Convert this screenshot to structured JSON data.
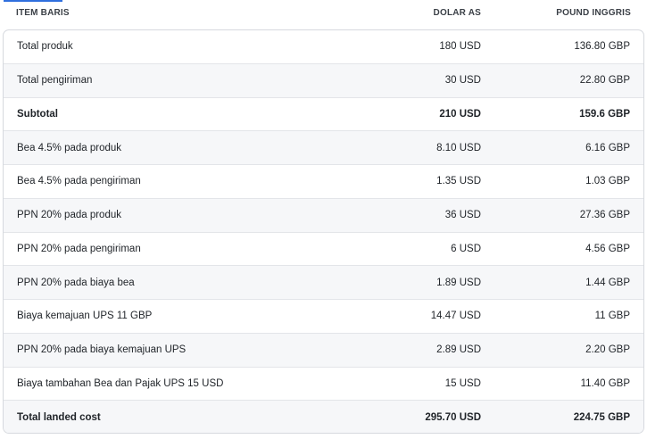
{
  "table": {
    "headers": {
      "item": "ITEM BARIS",
      "usd": "DOLAR AS",
      "gbp": "POUND INGGRIS"
    },
    "rows": [
      {
        "item": "Total produk",
        "usd": "180 USD",
        "gbp": "136.80 GBP"
      },
      {
        "item": "Total pengiriman",
        "usd": "30 USD",
        "gbp": "22.80 GBP"
      },
      {
        "item": "Subtotal",
        "usd": "210 USD",
        "gbp": "159.6 GBP"
      },
      {
        "item": "Bea 4.5% pada produk",
        "usd": "8.10 USD",
        "gbp": "6.16 GBP"
      },
      {
        "item": "Bea 4.5% pada pengiriman",
        "usd": "1.35 USD",
        "gbp": "1.03 GBP"
      },
      {
        "item": "PPN 20% pada produk",
        "usd": "36 USD",
        "gbp": "27.36 GBP"
      },
      {
        "item": "PPN 20% pada pengiriman",
        "usd": "6 USD",
        "gbp": "4.56 GBP"
      },
      {
        "item": "PPN 20% pada biaya bea",
        "usd": "1.89 USD",
        "gbp": "1.44 GBP"
      },
      {
        "item": "Biaya kemajuan UPS 11 GBP",
        "usd": "14.47 USD",
        "gbp": "11 GBP"
      },
      {
        "item": "PPN 20% pada biaya kemajuan UPS",
        "usd": "2.89 USD",
        "gbp": "2.20 GBP"
      },
      {
        "item": "Biaya tambahan Bea dan Pajak UPS 15 USD",
        "usd": "15 USD",
        "gbp": "11.40 GBP"
      },
      {
        "item": "Total landed cost",
        "usd": "295.70 USD",
        "gbp": "224.75 GBP"
      }
    ]
  },
  "colors": {
    "accent": "#2f6fde",
    "row_alt": "#f6f7f9",
    "border": "#d6d9de"
  }
}
